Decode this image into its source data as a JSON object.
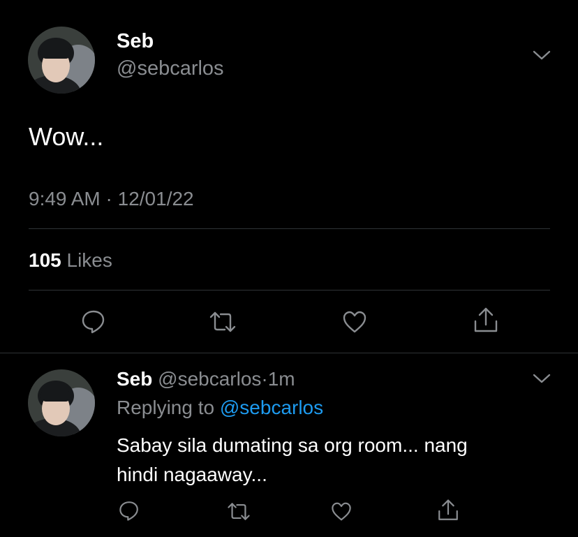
{
  "tweet": {
    "author_name": "Seb",
    "author_handle": "@sebcarlos",
    "text": "Wow...",
    "time": "9:49 AM",
    "separator": "·",
    "date": "12/01/22",
    "likes_count": "105",
    "likes_label": "Likes"
  },
  "reply": {
    "author_name": "Seb",
    "author_handle": "@sebcarlos",
    "separator": "·",
    "age": "1m",
    "replying_prefix": "Replying to",
    "replying_handle": "@sebcarlos",
    "text_line1": "Sabay sila dumating sa org room... nang",
    "text_line2": "hindi nagaaway..."
  },
  "colors": {
    "background": "#000000",
    "text_primary": "#ffffff",
    "text_secondary": "#8a8d91",
    "accent": "#1d9bf0",
    "divider": "#2f3336"
  },
  "icons": [
    "chevron-down-icon",
    "reply-icon",
    "retweet-icon",
    "like-icon",
    "share-icon"
  ]
}
